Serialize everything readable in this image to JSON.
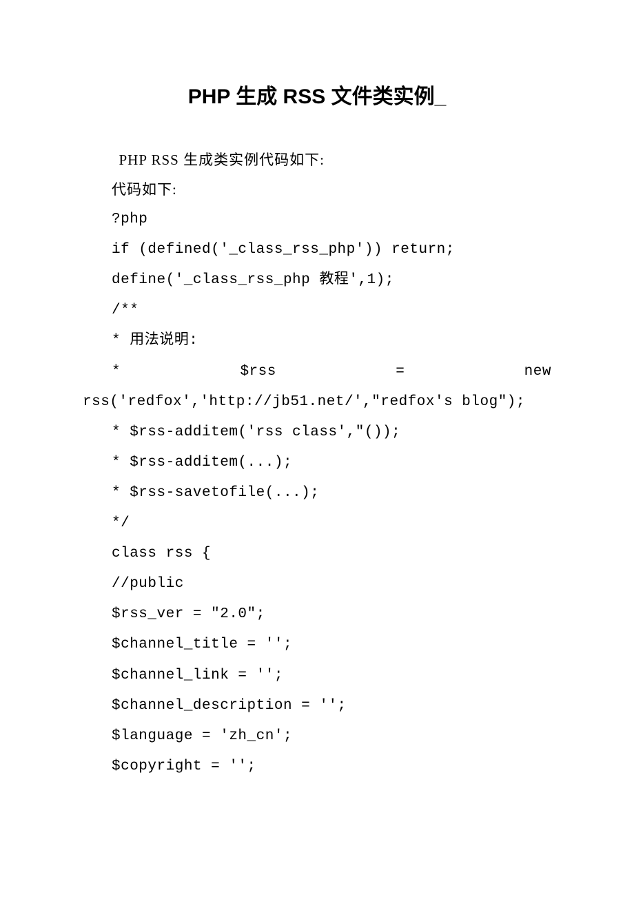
{
  "title": "PHP 生成 RSS 文件类实例_",
  "intro": "PHP RSS 生成类实例代码如下:",
  "label": "代码如下:",
  "code": {
    "l1": "?php",
    "l2": "if (defined('_class_rss_php')) return;",
    "l3": "define('_class_rss_php 教程',1);",
    "l4": "/**",
    "l5": "* 用法说明:",
    "l6a": "*",
    "l6b": "$rss",
    "l6c": "=",
    "l6d": "new",
    "l7": "rss('redfox','http://jb51.net/',\"redfox's blog\");",
    "l8": "* $rss-additem('rss class',\"());",
    "l9": "* $rss-additem(...);",
    "l10": "* $rss-savetofile(...);",
    "l11": "*/",
    "l12": "class rss {",
    "l13": "//public",
    "l14": "$rss_ver = \"2.0\";",
    "l15": "$channel_title = '';",
    "l16": "$channel_link = '';",
    "l17": "$channel_description = '';",
    "l18": "$language = 'zh_cn';",
    "l19": "$copyright = '';"
  }
}
